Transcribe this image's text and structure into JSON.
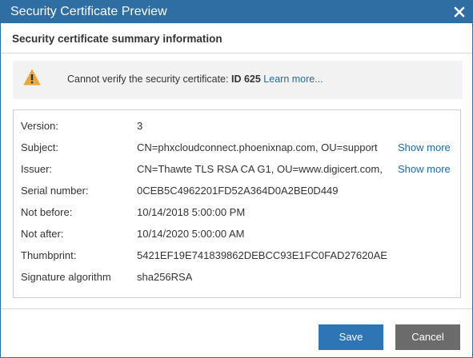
{
  "window": {
    "title": "Security Certificate Preview",
    "close_icon": "close-icon"
  },
  "summary": {
    "heading": "Security certificate summary information"
  },
  "warning": {
    "icon": "warning-icon",
    "text": "Cannot verify the security certificate:",
    "id": "ID 625",
    "link": "Learn more..."
  },
  "certificate": {
    "rows": [
      {
        "label": "Version:",
        "value": "3"
      },
      {
        "label": "Subject:",
        "value": "CN=phxcloudconnect.phoenixnap.com, OU=support",
        "more": "Show more"
      },
      {
        "label": "Issuer:",
        "value": "CN=Thawte TLS RSA CA G1, OU=www.digicert.com,",
        "more": "Show more"
      },
      {
        "label": "Serial number:",
        "value": "0CEB5C4962201FD52A364D0A2BE0D449"
      },
      {
        "label": "Not before:",
        "value": "10/14/2018 5:00:00 PM"
      },
      {
        "label": "Not after:",
        "value": "10/14/2020 5:00:00 AM"
      },
      {
        "label": "Thumbprint:",
        "value": "5421EF19E741839862DEBCC93E1FC0FAD27620AE"
      },
      {
        "label": "Signature algorithm",
        "value": "sha256RSA"
      }
    ]
  },
  "buttons": {
    "save": "Save",
    "cancel": "Cancel"
  },
  "colors": {
    "titlebar": "#2e6ea3",
    "link": "#1a6bb0",
    "save": "#2d75b5",
    "cancel": "#6b6b6b",
    "warning_icon": "#e8a93a"
  }
}
